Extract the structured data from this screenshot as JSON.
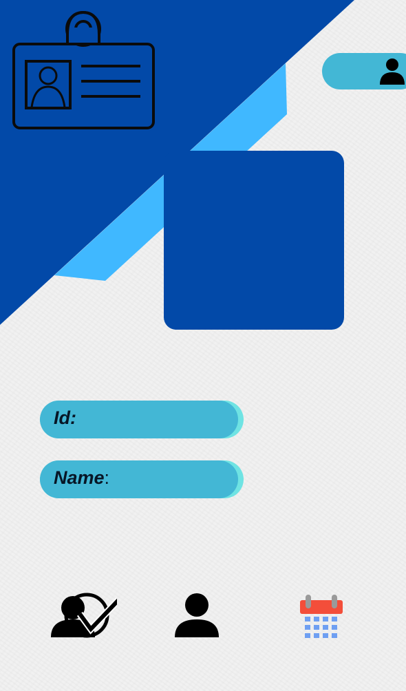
{
  "colors": {
    "dark_blue": "#0249a8",
    "light_blue": "#40b8ff",
    "field_teal": "#43b7d5",
    "field_edge": "#6fe3e3",
    "calendar_red": "#f34e3a",
    "calendar_blue": "#6e9ff2",
    "background": "#f2f2f2"
  },
  "header": {
    "id_card_icon": "id-card-icon",
    "profile_icon": "person-icon"
  },
  "form": {
    "id_label": "Id:",
    "name_label": "Name",
    "name_colon": ":"
  },
  "nav": {
    "items": [
      {
        "icon": "attendance-check-icon"
      },
      {
        "icon": "person-icon"
      },
      {
        "icon": "calendar-icon"
      }
    ]
  }
}
